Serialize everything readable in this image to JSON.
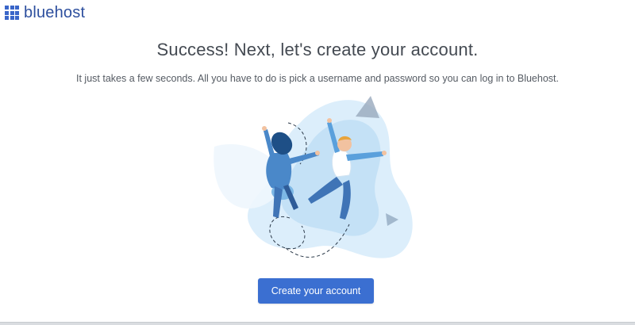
{
  "header": {
    "brand_name": "bluehost",
    "logo_icon": "grid-logo-icon"
  },
  "main": {
    "title": "Success! Next, let's create your account.",
    "subtitle": "It just takes a few seconds. All you have to do is pick a username and password so you can log in to Bluehost.",
    "illustration_icon": "celebrating-people-illustration",
    "cta_label": "Create your account"
  },
  "colors": {
    "brand": "#2d4f9e",
    "button": "#3b6fd1",
    "title_text": "#444a52",
    "illustration_light": "#d6ebfa",
    "illustration_dark": "#1e4f86"
  }
}
